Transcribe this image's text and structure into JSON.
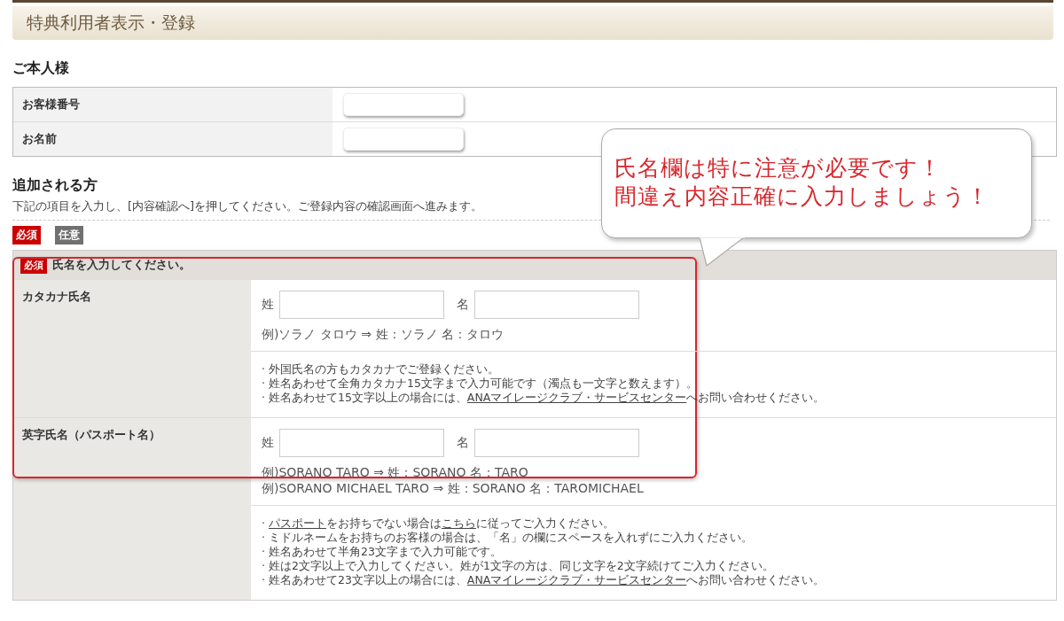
{
  "page_title": "特典利用者表示・登録",
  "self_section": {
    "heading": "ご本人様",
    "rows": [
      {
        "label": "お客様番号"
      },
      {
        "label": "お名前"
      }
    ]
  },
  "added_section": {
    "heading": "追加される方",
    "description": "下記の項目を入力し、[内容確認へ]を押してください。ご登録内容の確認画面へ進みます。",
    "legend": [
      {
        "label": "必須",
        "kind": "required"
      },
      {
        "label": "任意",
        "kind": "optional"
      }
    ]
  },
  "form": {
    "header": {
      "badge": "必須",
      "text": "氏名を入力してください。"
    },
    "rows": [
      {
        "label": "カタカナ氏名",
        "fields": [
          {
            "label": "姓"
          },
          {
            "label": "名"
          }
        ],
        "examples": [
          "例)ソラノ タロウ ⇒ 姓：ソラノ 名：タロウ"
        ],
        "notes": [
          [
            {
              "text": "· 外国氏名の方もカタカナでご登録ください。",
              "link": false
            }
          ],
          [
            {
              "text": "· 姓名あわせて全角カタカナ15文字まで入力可能です（濁点も一文字と数えます）。",
              "link": false
            }
          ],
          [
            {
              "text": "· 姓名あわせて15文字以上の場合には、",
              "link": false
            },
            {
              "text": "ANAマイレージクラブ・サービスセンター",
              "link": true
            },
            {
              "text": "へお問い合わせください。",
              "link": false
            }
          ]
        ]
      },
      {
        "label": "英字氏名（パスポート名）",
        "fields": [
          {
            "label": "姓"
          },
          {
            "label": "名"
          }
        ],
        "examples": [
          "例)SORANO TARO ⇒ 姓：SORANO 名：TARO",
          "例)SORANO MICHAEL TARO ⇒ 姓：SORANO 名：TAROMICHAEL"
        ],
        "notes": [
          [
            {
              "text": "· ",
              "link": false
            },
            {
              "text": "パスポート",
              "link": true
            },
            {
              "text": "をお持ちでない場合は",
              "link": false
            },
            {
              "text": "こちら",
              "link": true
            },
            {
              "text": "に従ってご入力ください。",
              "link": false
            }
          ],
          [
            {
              "text": "· ミドルネームをお持ちのお客様の場合は、「名」の欄にスペースを入れずにご入力ください。",
              "link": false
            }
          ],
          [
            {
              "text": "· 姓名あわせて半角23文字まで入力可能です。",
              "link": false
            }
          ],
          [
            {
              "text": "· 姓は2文字以上で入力してください。姓が1文字の方は、同じ文字を2文字続けてご入力ください。",
              "link": false
            }
          ],
          [
            {
              "text": "· 姓名あわせて23文字以上の場合には、",
              "link": false
            },
            {
              "text": "ANAマイレージクラブ・サービスセンター",
              "link": true
            },
            {
              "text": "へお問い合わせください。",
              "link": false
            }
          ]
        ]
      }
    ]
  },
  "callout": {
    "lines": [
      "氏名欄は特に注意が必要です！",
      "間違え内容正確に入力しましょう！"
    ]
  }
}
